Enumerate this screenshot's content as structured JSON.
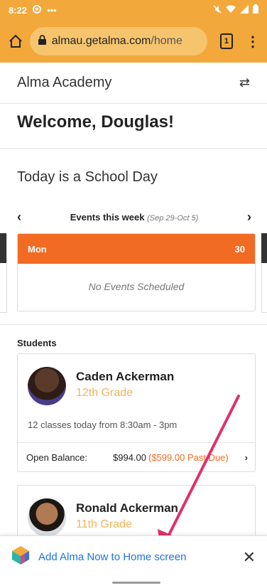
{
  "status_bar": {
    "time": "8:22",
    "dots": "•••"
  },
  "browser": {
    "url_domain": "almau.getalma.com",
    "url_path": "/home",
    "tab_count": "1"
  },
  "app": {
    "title": "Alma Academy",
    "welcome": "Welcome, Douglas!"
  },
  "school_day": "Today is a School Day",
  "events": {
    "label": "Events this week",
    "range": "(Sep 29-Oct 5)",
    "day_name": "Mon",
    "day_number": "30",
    "empty_text": "No Events Scheduled"
  },
  "students": {
    "label": "Students",
    "items": [
      {
        "name": "Caden Ackerman",
        "grade": "12th Grade",
        "classes": "12 classes today from 8:30am - 3pm",
        "balance_label": "Open Balance:",
        "balance_amount": "$994.00",
        "past_due": "($599.00 Past Due)"
      },
      {
        "name": "Ronald Ackerman",
        "grade": "11th Grade"
      }
    ]
  },
  "install_banner": {
    "text": "Add Alma Now to Home screen"
  },
  "colors": {
    "toolbar": "#f2a83a",
    "accent": "#f26b23",
    "grade": "#f5b35a",
    "link": "#1a73e8",
    "arrow": "#e0306a"
  }
}
